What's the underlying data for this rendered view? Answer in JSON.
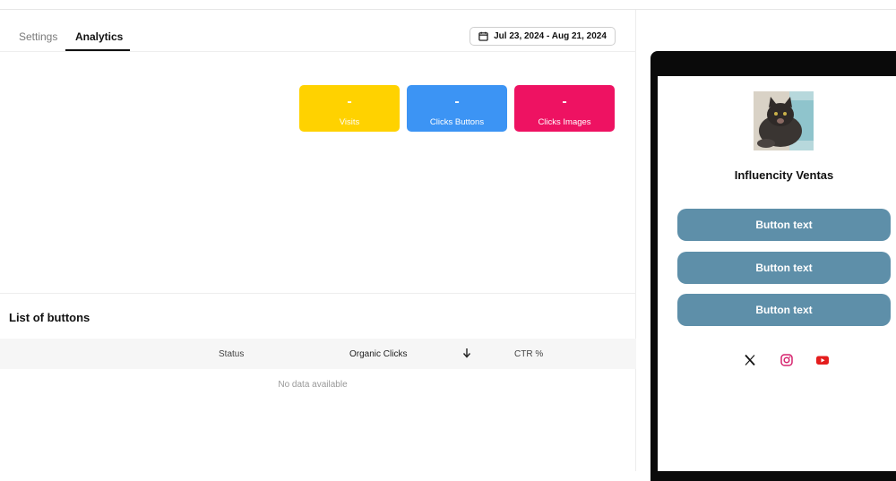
{
  "tabs": [
    {
      "label": "Settings",
      "active": false
    },
    {
      "label": "Analytics",
      "active": true
    }
  ],
  "date_range": "Jul 23, 2024 - Aug 21, 2024",
  "stats": [
    {
      "value": "-",
      "label": "Visits",
      "color": "#ffd200"
    },
    {
      "value": "-",
      "label": "Clicks Buttons",
      "color": "#3c94f4"
    },
    {
      "value": "-",
      "label": "Clicks Images",
      "color": "#ee1262"
    }
  ],
  "list": {
    "title": "List of buttons",
    "columns": [
      "Status",
      "Organic Clicks",
      "CTR %"
    ],
    "sort_icon": "arrow-down-icon",
    "empty_text": "No data available"
  },
  "preview": {
    "profile_name": "Influencity Ventas",
    "button_color": "#5e8fa9",
    "buttons": [
      "Button text",
      "Button text",
      "Button text"
    ],
    "social_icons": [
      "x-icon",
      "instagram-icon",
      "youtube-icon"
    ]
  }
}
